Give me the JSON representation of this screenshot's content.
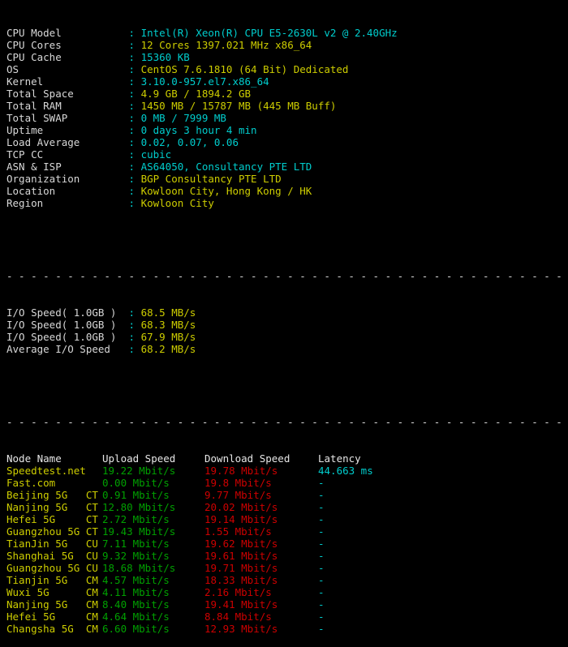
{
  "terminal": {
    "background": "#000000",
    "colors": {
      "label": "#d8d8d8",
      "cyan": "#00cdcd",
      "yellow": "#cdcd00",
      "green": "#00a000",
      "red": "#cd0000",
      "separator": "#d8d8d8"
    }
  },
  "system_info": [
    {
      "label": "CPU Model",
      "sep": ":",
      "value": "Intel(R) Xeon(R) CPU E5-2630L v2 @ 2.40GHz",
      "color": "cyan"
    },
    {
      "label": "CPU Cores",
      "sep": ":",
      "value": "12 Cores 1397.021 MHz x86_64",
      "color": "yellow"
    },
    {
      "label": "CPU Cache",
      "sep": ":",
      "value": "15360 KB",
      "color": "cyan"
    },
    {
      "label": "OS",
      "sep": ":",
      "value": "CentOS 7.6.1810 (64 Bit) Dedicated",
      "color": "yellow"
    },
    {
      "label": "Kernel",
      "sep": ":",
      "value": "3.10.0-957.el7.x86_64",
      "color": "cyan"
    },
    {
      "label": "Total Space",
      "sep": ":",
      "value": "4.9 GB / 1894.2 GB",
      "color": "yellow"
    },
    {
      "label": "Total RAM",
      "sep": ":",
      "value": "1450 MB / 15787 MB (445 MB Buff)",
      "color": "yellow"
    },
    {
      "label": "Total SWAP",
      "sep": ":",
      "value": "0 MB / 7999 MB",
      "color": "cyan"
    },
    {
      "label": "Uptime",
      "sep": ":",
      "value": "0 days 3 hour 4 min",
      "color": "cyan"
    },
    {
      "label": "Load Average",
      "sep": ":",
      "value": "0.02, 0.07, 0.06",
      "color": "cyan"
    },
    {
      "label": "TCP CC",
      "sep": ":",
      "value": "cubic",
      "color": "cyan"
    },
    {
      "label": "ASN & ISP",
      "sep": ":",
      "value": "AS64050, Consultancy PTE LTD",
      "color": "cyan"
    },
    {
      "label": "Organization",
      "sep": ":",
      "value": "BGP Consultancy PTE LTD",
      "color": "yellow"
    },
    {
      "label": "Location",
      "sep": ":",
      "value": "Kowloon City, Hong Kong / HK",
      "color": "yellow"
    },
    {
      "label": "Region",
      "sep": ":",
      "value": "Kowloon City",
      "color": "yellow"
    }
  ],
  "separator_line": "- - - - - - - - - - - - - - - - - - - - - - - - - - - - - - - - - - - - - - - - - - - - - - - - - -",
  "io_speed": [
    {
      "label": "I/O Speed( 1.0GB )",
      "sep": ":",
      "value": "68.5 MB/s",
      "color": "yellow"
    },
    {
      "label": "I/O Speed( 1.0GB )",
      "sep": ":",
      "value": "68.3 MB/s",
      "color": "yellow"
    },
    {
      "label": "I/O Speed( 1.0GB )",
      "sep": ":",
      "value": "67.9 MB/s",
      "color": "yellow"
    },
    {
      "label": "Average I/O Speed",
      "sep": ":",
      "value": "68.2 MB/s",
      "color": "yellow"
    }
  ],
  "speedtest": {
    "headers": {
      "node": "Node Name",
      "upload": "Upload Speed",
      "download": "Download Speed",
      "latency": "Latency"
    },
    "rows": [
      {
        "node": "Speedtest.net",
        "isp": "",
        "upload": "19.22 Mbit/s",
        "download": "19.78 Mbit/s",
        "latency": "44.663 ms"
      },
      {
        "node": "Fast.com",
        "isp": "",
        "upload": "0.00 Mbit/s",
        "download": "19.8 Mbit/s",
        "latency": "-"
      },
      {
        "node": "Beijing 5G",
        "isp": "CT",
        "upload": "0.91 Mbit/s",
        "download": "9.77 Mbit/s",
        "latency": "-"
      },
      {
        "node": "Nanjing 5G",
        "isp": "CT",
        "upload": "12.80 Mbit/s",
        "download": "20.02 Mbit/s",
        "latency": "-"
      },
      {
        "node": "Hefei 5G",
        "isp": "CT",
        "upload": "2.72 Mbit/s",
        "download": "19.14 Mbit/s",
        "latency": "-"
      },
      {
        "node": "Guangzhou 5G",
        "isp": "CT",
        "upload": "19.43 Mbit/s",
        "download": "1.55 Mbit/s",
        "latency": "-"
      },
      {
        "node": "TianJin 5G",
        "isp": "CU",
        "upload": "7.11 Mbit/s",
        "download": "19.62 Mbit/s",
        "latency": "-"
      },
      {
        "node": "Shanghai 5G",
        "isp": "CU",
        "upload": "9.32 Mbit/s",
        "download": "19.61 Mbit/s",
        "latency": "-"
      },
      {
        "node": "Guangzhou 5G",
        "isp": "CU",
        "upload": "18.68 Mbit/s",
        "download": "19.71 Mbit/s",
        "latency": "-"
      },
      {
        "node": "Tianjin 5G",
        "isp": "CM",
        "upload": "4.57 Mbit/s",
        "download": "18.33 Mbit/s",
        "latency": "-"
      },
      {
        "node": "Wuxi 5G",
        "isp": "CM",
        "upload": "4.11 Mbit/s",
        "download": "2.16 Mbit/s",
        "latency": "-"
      },
      {
        "node": "Nanjing 5G",
        "isp": "CM",
        "upload": "8.40 Mbit/s",
        "download": "19.41 Mbit/s",
        "latency": "-"
      },
      {
        "node": "Hefei 5G",
        "isp": "CM",
        "upload": "4.64 Mbit/s",
        "download": "8.84 Mbit/s",
        "latency": "-"
      },
      {
        "node": "Changsha 5G",
        "isp": "CM",
        "upload": "6.60 Mbit/s",
        "download": "12.93 Mbit/s",
        "latency": "-"
      }
    ]
  }
}
